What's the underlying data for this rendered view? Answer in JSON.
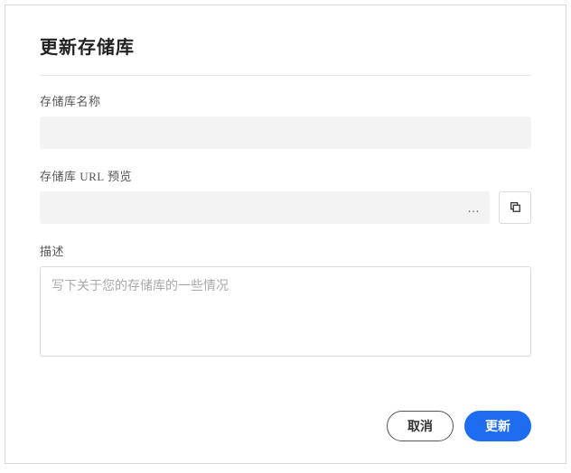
{
  "dialog": {
    "title": "更新存储库",
    "fields": {
      "name": {
        "label": "存储库名称",
        "value": ""
      },
      "url": {
        "label": "存储库 URL 预览",
        "value": "",
        "truncated": "…"
      },
      "description": {
        "label": "描述",
        "placeholder": "写下关于您的存储库的一些情况",
        "value": ""
      }
    },
    "icons": {
      "copy": "copy-icon"
    },
    "actions": {
      "cancel": "取消",
      "submit": "更新"
    }
  }
}
